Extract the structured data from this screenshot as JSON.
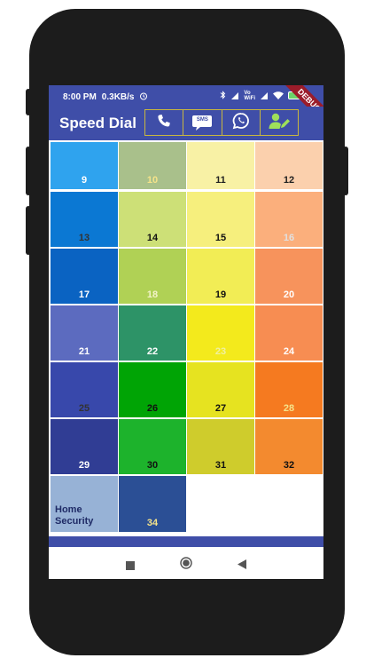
{
  "status": {
    "time": "8:00 PM",
    "speed": "0.3KB/s",
    "vo_label": "Vo\nWiFi",
    "battery": "",
    "debug": "DEBUG"
  },
  "app": {
    "title": "Speed Dial",
    "actions": [
      {
        "name": "phone-icon"
      },
      {
        "name": "sms-icon",
        "label": "SMS"
      },
      {
        "name": "whatsapp-icon"
      },
      {
        "name": "contact-edit-icon"
      }
    ],
    "accent": "#3f4ea8"
  },
  "tiles": [
    {
      "label": "9",
      "bg": "#2fa3ee",
      "fg": "#ffffff"
    },
    {
      "label": "10",
      "bg": "#a9c08b",
      "fg": "#f5e38a"
    },
    {
      "label": "11",
      "bg": "#f8f1a5",
      "fg": "#222222"
    },
    {
      "label": "12",
      "bg": "#fbd0ad",
      "fg": "#222222"
    },
    {
      "label": "13",
      "bg": "#0b78d3",
      "fg": "#333333"
    },
    {
      "label": "14",
      "bg": "#cde077",
      "fg": "#111111"
    },
    {
      "label": "15",
      "bg": "#f6ef7d",
      "fg": "#111111"
    },
    {
      "label": "16",
      "bg": "#fbaf7c",
      "fg": "#e0e0e0"
    },
    {
      "label": "17",
      "bg": "#0a63c2",
      "fg": "#ffffff"
    },
    {
      "label": "18",
      "bg": "#b0d155",
      "fg": "#f3f3c8"
    },
    {
      "label": "19",
      "bg": "#f2ed55",
      "fg": "#111111"
    },
    {
      "label": "20",
      "bg": "#f7935c",
      "fg": "#ffffff"
    },
    {
      "label": "21",
      "bg": "#5c6bbf",
      "fg": "#ffffff"
    },
    {
      "label": "22",
      "bg": "#2d9367",
      "fg": "#ffffff"
    },
    {
      "label": "23",
      "bg": "#f3ea1c",
      "fg": "#f0f0a0"
    },
    {
      "label": "24",
      "bg": "#f78d52",
      "fg": "#ffffff"
    },
    {
      "label": "25",
      "bg": "#3848ab",
      "fg": "#333333"
    },
    {
      "label": "26",
      "bg": "#00a405",
      "fg": "#111111"
    },
    {
      "label": "27",
      "bg": "#e6e320",
      "fg": "#111111"
    },
    {
      "label": "28",
      "bg": "#f57a20",
      "fg": "#f5e38a"
    },
    {
      "label": "29",
      "bg": "#303d94",
      "fg": "#ffffff"
    },
    {
      "label": "30",
      "bg": "#1db32c",
      "fg": "#111111"
    },
    {
      "label": "31",
      "bg": "#cfcc2c",
      "fg": "#111111"
    },
    {
      "label": "32",
      "bg": "#f38a2f",
      "fg": "#111111"
    },
    {
      "label": "Home\nSecurity",
      "bg": "#97b2d6",
      "fg": "#1f2b66"
    },
    {
      "label": "34",
      "bg": "#2b4f95",
      "fg": "#f5e38a"
    }
  ]
}
